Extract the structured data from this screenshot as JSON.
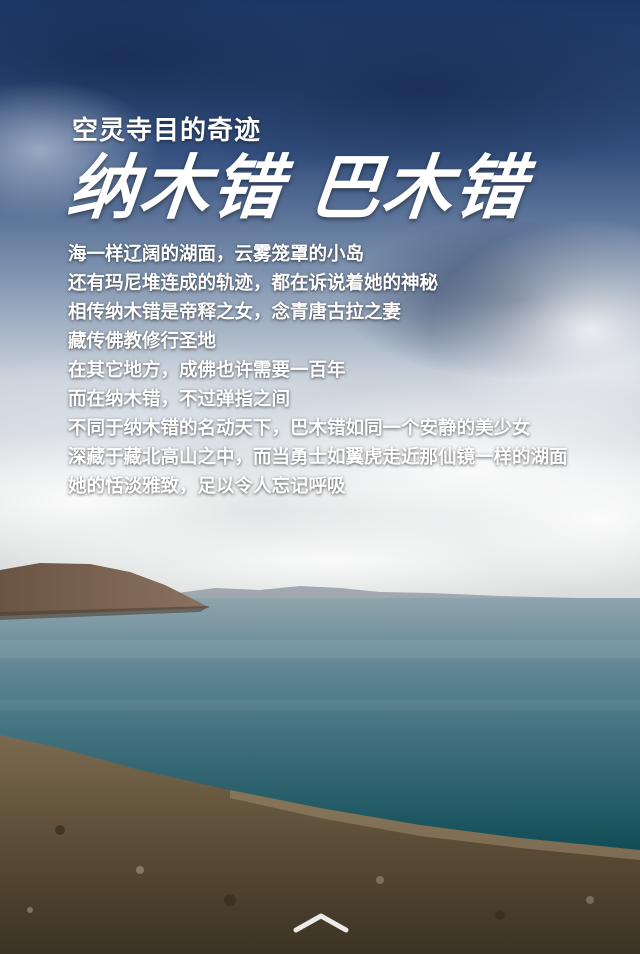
{
  "header": {
    "subtitle": "空灵寺目的奇迹",
    "title": "纳木错 巴木错"
  },
  "poem": {
    "lines": [
      "海一样辽阔的湖面，云雾笼罩的小岛",
      "还有玛尼堆连成的轨迹，都在诉说着她的神秘",
      "相传纳木错是帝释之女，念青唐古拉之妻",
      "藏传佛教修行圣地",
      "在其它地方，成佛也许需要一百年",
      "而在纳木错，不过弹指之间",
      "不同于纳木错的名动天下，巴木错如同一个安静的美少女",
      "深藏于藏北高山之中，而当勇士如翼虎走近那仙镜一样的湖面",
      "她的恬淡雅致，足以令人忘记呼吸"
    ]
  },
  "navigation": {
    "swipe_icon": "chevron-up-icon"
  },
  "colors": {
    "sky_top": "#1d3a6b",
    "sky_mid": "#7f95b4",
    "horizon": "#e6e8ea",
    "lake": "#3f6e7f",
    "lake_deep": "#0f4a55",
    "shore": "#6b5d45",
    "text": "#ffffff"
  }
}
